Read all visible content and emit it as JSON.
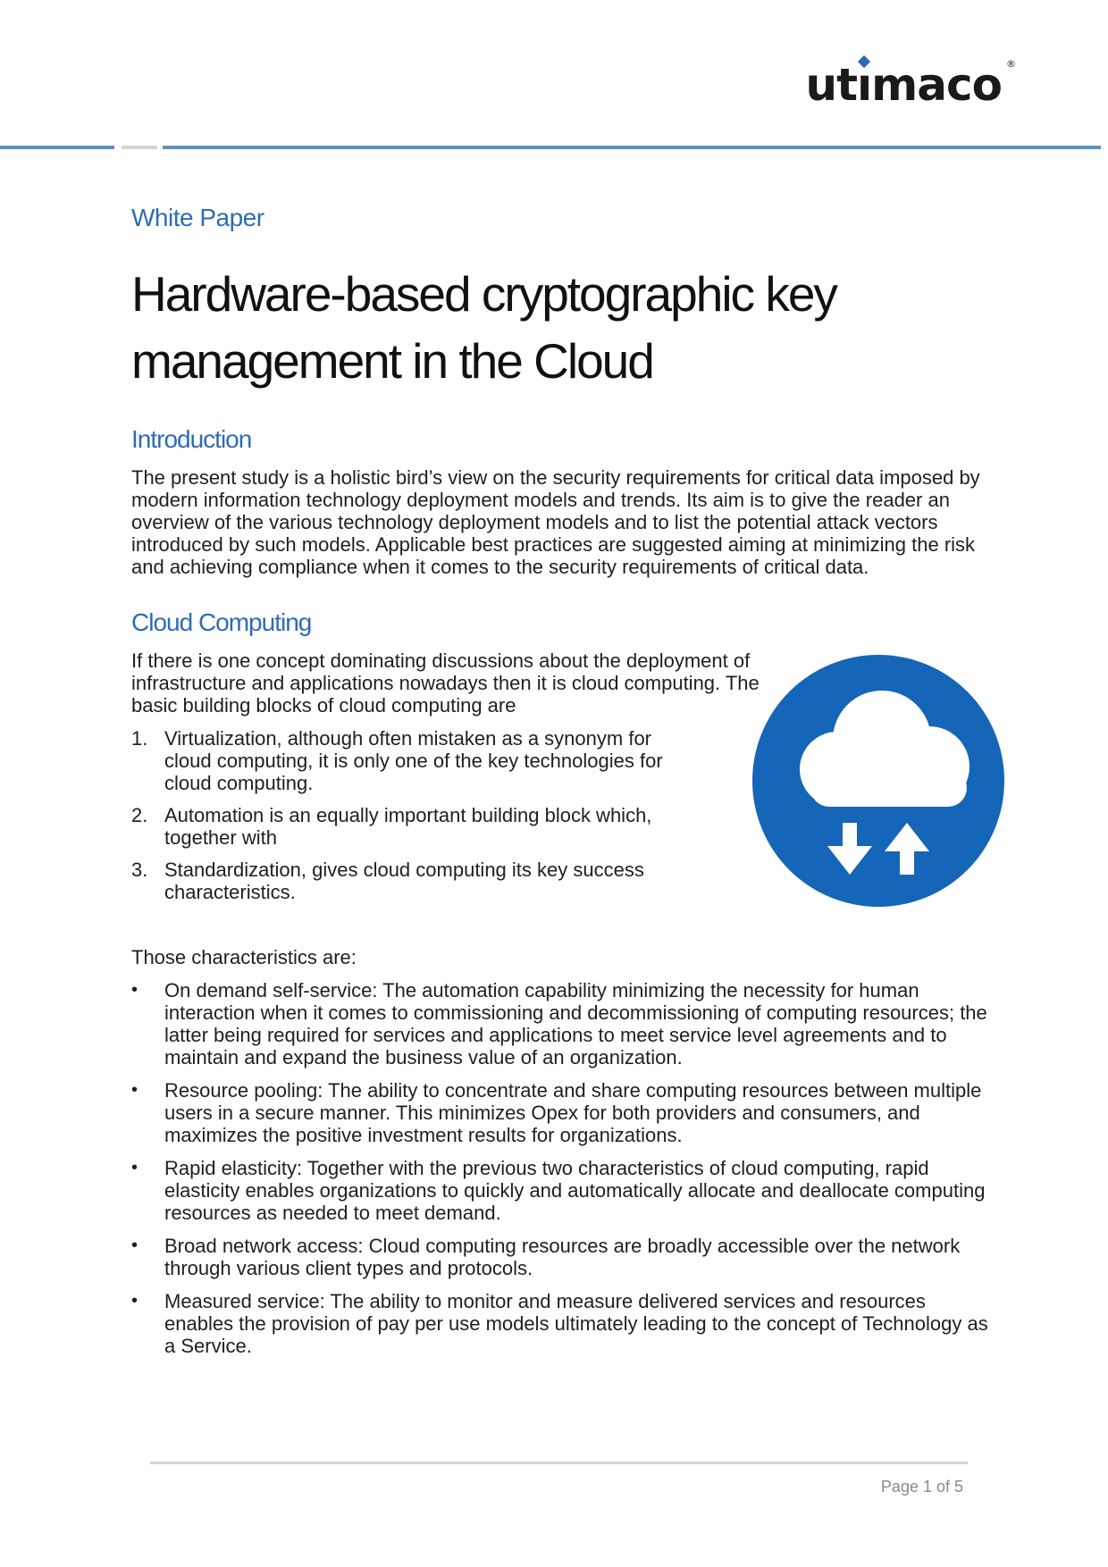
{
  "header": {
    "logo_text_pre": "ut",
    "logo_text_i": "ı",
    "logo_text_post": "maco",
    "logo_reg": "®",
    "brand_color": "#2f67b1",
    "rule_color": "#5b8fcb"
  },
  "document": {
    "type": "White Paper",
    "title": "Hardware-based cryptographic key management in the Cloud"
  },
  "introduction": {
    "heading": "Introduction",
    "body": "The present study is a holistic bird’s view on the security requirements for critical data imposed by modern information technology deployment models and trends. Its aim is to give the reader an overview of the various technology deployment models and to list the potential attack vectors introduced by such models. Applicable best practices are suggested aiming at minimizing the risk and achieving compliance when it comes to the security requirements of critical data."
  },
  "cloud_computing": {
    "heading": "Cloud Computing",
    "body": "If there is one concept dominating discussions about the deployment of infrastructure and applications nowadays then it is cloud computing. The basic building blocks of cloud computing are",
    "icon": "cloud-upload-download-icon",
    "icon_color": "#1565b8",
    "items": [
      {
        "num": "1.",
        "text": "Virtualization, although often mistaken as a synonym for cloud computing, it is only one of the key technologies for cloud computing."
      },
      {
        "num": "2.",
        "text": "Automation is an equally important building block which, together with"
      },
      {
        "num": "3.",
        "text": "Standardization, gives cloud computing its key success characteristics."
      }
    ]
  },
  "characteristics": {
    "intro": "Those characteristics are:",
    "bullet": "•",
    "items": [
      {
        "text": "On demand self-service: The automation capability minimizing the necessity for human interaction when it comes to commissioning and decommissioning of computing resources; the latter being required for services and applications to meet service level agreements and to maintain and expand the business value of an organization."
      },
      {
        "text": "Resource pooling: The ability to concentrate and share computing resources between multiple users in a secure manner. This minimizes Opex for both providers and consumers, and maximizes the positive investment results for organizations."
      },
      {
        "text": "Rapid elasticity: Together with the previous two characteristics of cloud computing, rapid elasticity enables organizations to quickly and automatically allocate and deallocate computing resources as needed to meet demand."
      },
      {
        "text": "Broad network access: Cloud computing resources are broadly accessible over the network through various client types and protocols."
      },
      {
        "text": "Measured service: The ability to monitor and measure delivered services and resources enables the provision of pay per use models ultimately leading to the concept of Technology as a Service."
      }
    ]
  },
  "footer": {
    "page_label": "Page 1 of 5"
  }
}
